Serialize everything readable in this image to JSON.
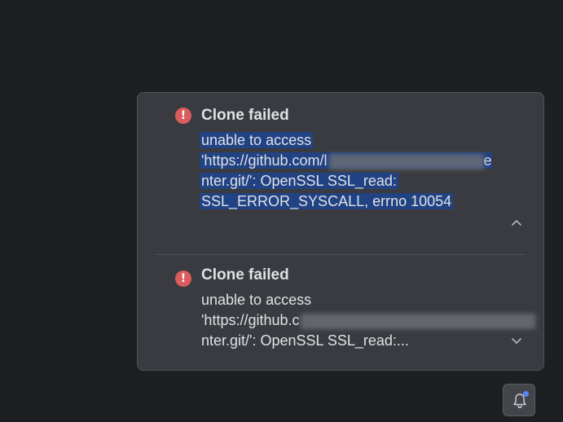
{
  "notifications": [
    {
      "title": "Clone failed",
      "lines": [
        "unable to access",
        "'https://github.com/l",
        "e",
        "nter.git/': OpenSSL SSL_read:",
        "SSL_ERROR_SYSCALL, errno 10054"
      ],
      "expanded": true,
      "chevron": "chevron-up-icon"
    },
    {
      "title": "Clone failed",
      "lines": [
        "unable to access",
        "'https://github.c",
        "nter.git/': OpenSSL SSL_read:..."
      ],
      "expanded": false,
      "chevron": "chevron-down-icon"
    }
  ],
  "icons": {
    "error": "error-icon",
    "bell": "bell-icon",
    "badge": "notification-badge"
  },
  "colors": {
    "background": "#1e1f22",
    "panel": "#393b40",
    "text": "#dfe1e5",
    "error": "#db5c5c",
    "selection": "#214283",
    "badge": "#548af7"
  }
}
